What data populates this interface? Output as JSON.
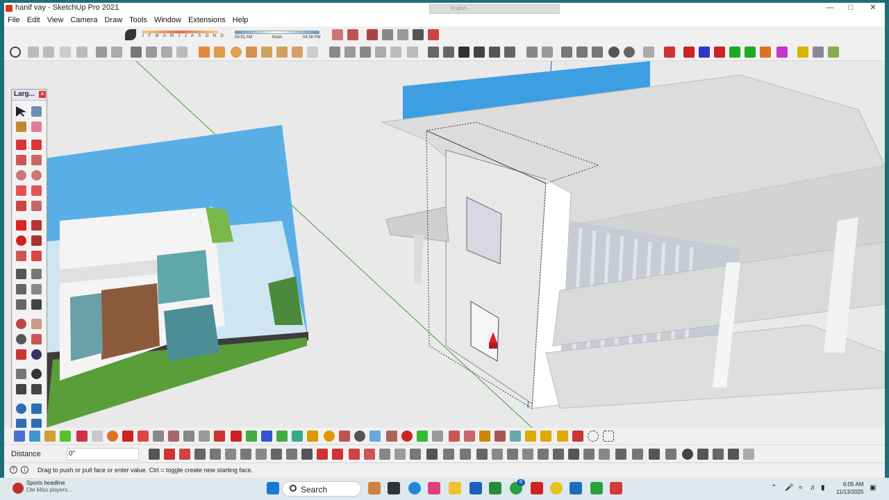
{
  "window": {
    "title": "hanif vay - SketchUp Pro 2021",
    "language": "English"
  },
  "menu": [
    "File",
    "Edit",
    "View",
    "Camera",
    "Draw",
    "Tools",
    "Window",
    "Extensions",
    "Help"
  ],
  "shadows": {
    "months": "J F M A M J J A S O N D",
    "time_start": "06:51 AM",
    "time_mid": "Noon",
    "time_end": "04:38 PM"
  },
  "palette": {
    "title": "Larg..."
  },
  "measurements": {
    "label": "Distance",
    "value": "0\""
  },
  "status": {
    "message": "Drag to push or pull face or enter value.  Ctrl = toggle create new starting face."
  },
  "taskbar": {
    "news_title": "Sports headline",
    "news_sub": "Ole Miss players...",
    "search_placeholder": "Search",
    "time": "6:05 AM",
    "date": "11/13/2025",
    "notif_count": "6"
  },
  "colors": {
    "accent": "#d4381c",
    "taskbar": "#dfe8ec",
    "sky": "#4a9fd8",
    "axis_green": "#3aa03a",
    "axis_blue": "#3a4ad8",
    "push_red": "#e02020"
  }
}
